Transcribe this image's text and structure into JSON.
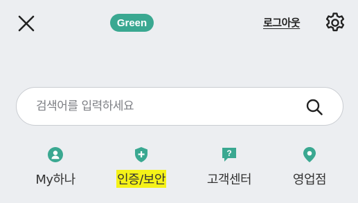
{
  "header": {
    "badge": "Green",
    "logout_label": "로그아웃"
  },
  "search": {
    "placeholder": "검색어를 입력하세요"
  },
  "nav": {
    "items": [
      {
        "label": "My하나",
        "icon": "person-icon"
      },
      {
        "label": "인증/보안",
        "icon": "shield-plus-icon",
        "highlighted": true
      },
      {
        "label": "고객센터",
        "icon": "question-chat-icon"
      },
      {
        "label": "영업점",
        "icon": "map-pin-icon"
      }
    ]
  },
  "colors": {
    "accent": "#3aa891",
    "background": "#eceef1",
    "highlight": "#f5f218"
  }
}
